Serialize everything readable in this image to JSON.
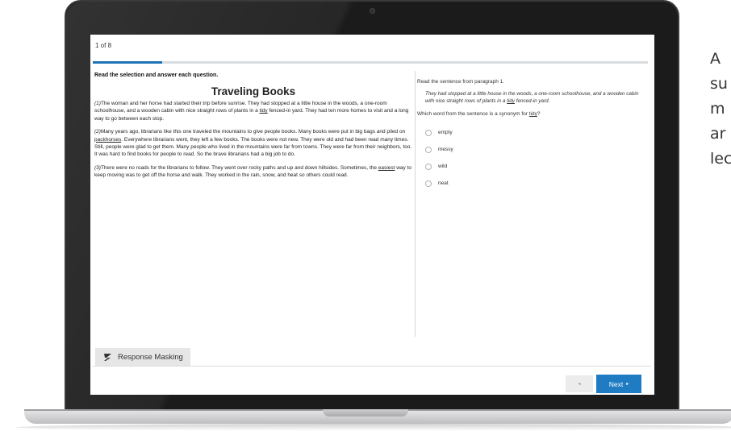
{
  "colors": {
    "accent": "#1f74b8",
    "next_button": "#1f7bc2",
    "mask_bg": "#e6e6e6"
  },
  "progress": {
    "label": "1 of 8",
    "fraction": 0.125
  },
  "passage": {
    "instructions": "Read the selection and answer each question.",
    "title": "Traveling Books",
    "paragraphs": [
      {
        "num": "(1)",
        "before": "The woman and her horse had started their trip before sunrise. They had stopped at a little house in the woods, a one-room schoolhouse, and a wooden cabin with nice straight rows of plants in a ",
        "underline": "tidy",
        "after": " fenced-in yard. They had ten more homes to visit and a long way to go between each stop."
      },
      {
        "num": "(2)",
        "before": "Many years ago, librarians like this one traveled the mountains to give people books. Many books were put in big bags and piled on ",
        "underline": "packhorses",
        "after": ". Everywhere librarians went, they left a few books. The books were not new. They were old and had been read many times. Still, people were glad to get them. Many people who lived in the mountains were far from towns. They were far from their neighbors, too. It was hard to find books for people to read. So the brave librarians had a big job to do."
      },
      {
        "num": "(3)",
        "before": "There were no roads for the librarians to follow. They went over rocky paths and up and down hillsides. Sometimes, the ",
        "underline": "easiest",
        "after": " way to keep moving was to get off the horse and walk. They worked in the rain, snow, and heat so others could read."
      }
    ]
  },
  "question": {
    "intro": "Read the sentence from paragraph 1.",
    "quote_before": "They had stopped at a little house in the woods, a one-room schoolhouse, and a wooden cabin with nice straight rows of plants in a ",
    "quote_underline": "tidy",
    "quote_after": " fenced-in yard.",
    "stem_before": "Which word from the sentence is a synonym for ",
    "stem_underline": "tidy",
    "stem_after": "?",
    "options": [
      "empty",
      "messy",
      "wild",
      "neat"
    ]
  },
  "toolbar": {
    "mask_icon": "response-masking-icon",
    "mask_label": "Response Masking",
    "prev_label": "◂",
    "next_label": "Next",
    "next_arrow": "▸"
  },
  "side_text": {
    "lines": [
      "A",
      "su",
      "m",
      "ar",
      "lec"
    ]
  }
}
